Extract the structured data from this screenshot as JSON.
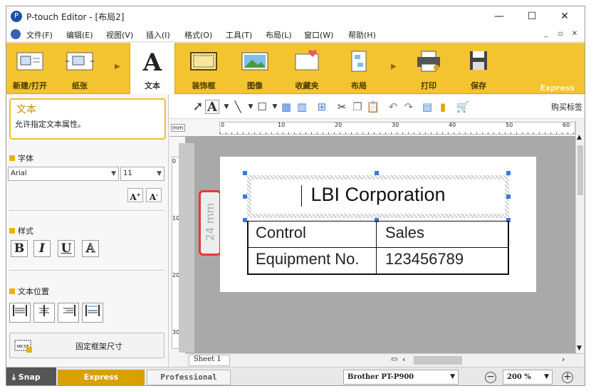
{
  "window": {
    "title": "P-touch Editor - [布局2]",
    "minimize": "—",
    "maximize": "☐",
    "close": "✕"
  },
  "menu": {
    "items": [
      "文件(F)",
      "编辑(E)",
      "视图(V)",
      "插入(I)",
      "格式(O)",
      "工具(T)",
      "布局(L)",
      "窗口(W)",
      "帮助(H)"
    ],
    "right": [
      "_",
      "▫",
      "✕"
    ]
  },
  "ribbon": {
    "new_open": "新建/打开",
    "paper": "纸张",
    "text": "文本",
    "frame": "装饰框",
    "image": "图像",
    "favorites": "收藏夹",
    "layout": "布局",
    "print": "打印",
    "save": "保存",
    "express": "Express"
  },
  "tip": {
    "title": "文本",
    "description": "允许指定文本属性。"
  },
  "font": {
    "section": "字体",
    "family": "Arial",
    "size": "11"
  },
  "style": {
    "section": "样式",
    "bold": "B",
    "italic": "I",
    "underline": "U",
    "outline": "A"
  },
  "position": {
    "section": "文本位置"
  },
  "fixed_frame": {
    "label": "固定框架尺寸",
    "icon_text": "ABCDE"
  },
  "toolbar": {
    "buy": "购买标签"
  },
  "ruler": {
    "unit": "mm",
    "h_labels": [
      "0",
      "10",
      "20",
      "30",
      "40",
      "50",
      "60"
    ],
    "v_labels": [
      "0",
      "10",
      "20",
      "30"
    ]
  },
  "label": {
    "tape_width": "24 mm",
    "title": "LBI Corporation",
    "table": [
      [
        "Control",
        "Sales"
      ],
      [
        "Equipment No.",
        "123456789"
      ]
    ]
  },
  "sheet": {
    "name": "Sheet 1"
  },
  "status": {
    "snap": "Snap",
    "express": "Express",
    "professional": "Professional",
    "printer": "Brother PT-P900",
    "zoom": "200 %"
  },
  "colors": {
    "ribbon": "#f4c430",
    "express_tab": "#d8a000",
    "highlight": "#e53935",
    "handle": "#3a7bd5"
  }
}
